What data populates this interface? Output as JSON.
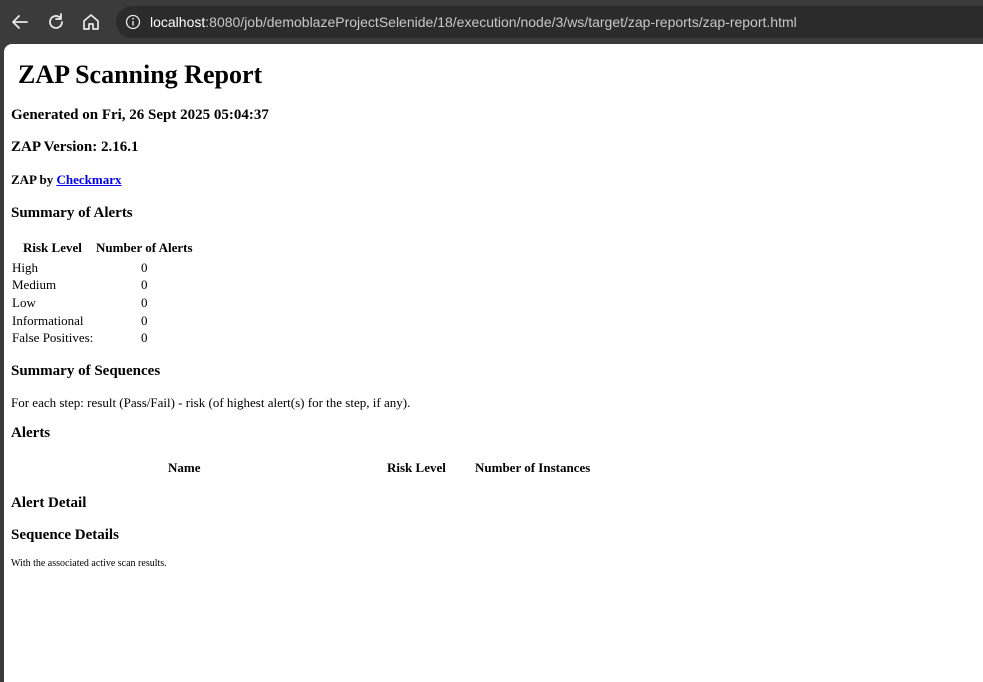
{
  "browser": {
    "url_host": "localhost",
    "url_rest": ":8080/job/demoblazeProjectSelenide/18/execution/node/3/ws/target/zap-reports/zap-report.html"
  },
  "report": {
    "title": "ZAP Scanning Report",
    "generated": "Generated on Fri, 26 Sept 2025 05:04:37",
    "version": "ZAP Version: 2.16.1",
    "by_prefix": "ZAP by",
    "by_link": "Checkmarx",
    "summary_alerts_heading": "Summary of Alerts",
    "summary_table": {
      "headers": [
        "Risk Level",
        "Number of Alerts"
      ],
      "rows": [
        {
          "label": "High",
          "value": "0"
        },
        {
          "label": "Medium",
          "value": "0"
        },
        {
          "label": "Low",
          "value": "0"
        },
        {
          "label": "Informational",
          "value": "0"
        },
        {
          "label": "False Positives:",
          "value": "0"
        }
      ]
    },
    "summary_sequences_heading": "Summary of Sequences",
    "sequences_note": "For each step: result (Pass/Fail) - risk (of highest alert(s) for the step, if any).",
    "alerts_heading": "Alerts",
    "alerts_table_headers": [
      "Name",
      "Risk Level",
      "Number of Instances"
    ],
    "alert_detail_heading": "Alert Detail",
    "sequence_details_heading": "Sequence Details",
    "sequence_details_note": "With the associated active scan results."
  }
}
